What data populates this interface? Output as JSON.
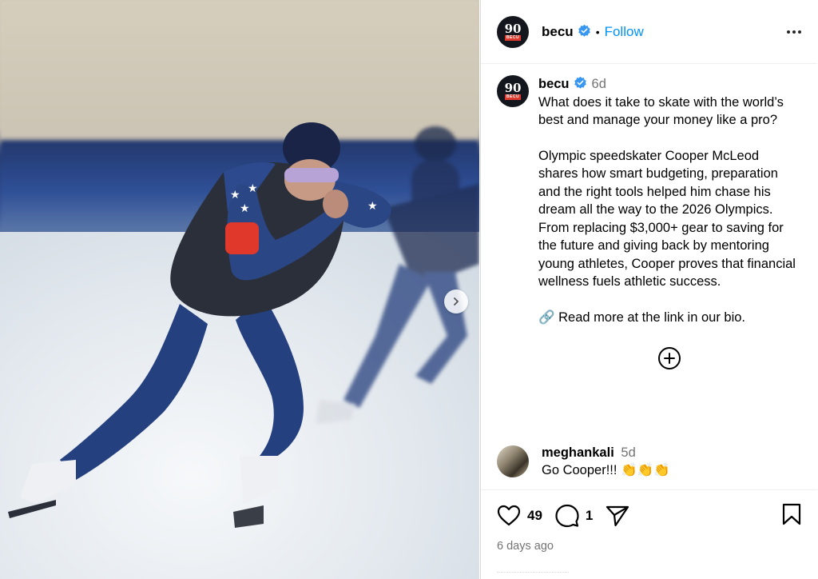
{
  "post": {
    "username": "becu",
    "avatar_text": "90",
    "avatar_tag": "BECU",
    "follow_label": "Follow",
    "separator": "•",
    "verified_icon": "verified-badge-icon",
    "caption_time": "6d",
    "caption_line1": "What does it take to skate with the world’s best and manage your money like a pro?",
    "caption_line2": "Olympic speedskater Cooper McLeod shares how smart budgeting, preparation and the right tools helped him chase his dream all the way to the 2026 Olympics. From replacing $3,000+ gear to saving for the future and giving back by mentoring young athletes, Cooper proves that financial wellness fuels athletic success.",
    "caption_line3": "🔗 Read more at the link in our bio.",
    "likes": "49",
    "comments_count": "1",
    "posted_ago": "6 days ago"
  },
  "comment": {
    "username": "meghankali",
    "time": "5d",
    "text": "Go Cooper!!! 👏👏👏"
  },
  "colors": {
    "follow": "#0095f6",
    "verified": "#3897f0",
    "muted": "#737373"
  }
}
